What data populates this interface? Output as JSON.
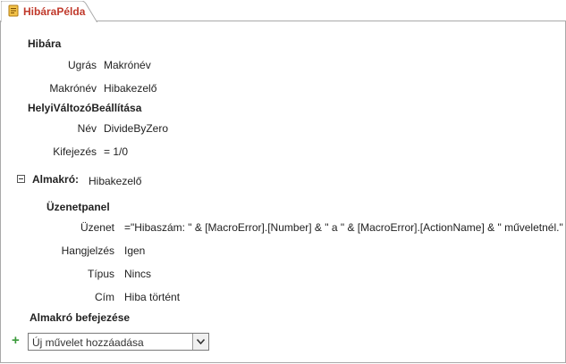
{
  "tab": {
    "title": "HibáraPélda",
    "icon": "macro-scroll-icon"
  },
  "actions": {
    "onerror": {
      "name": "Hibára",
      "args": [
        {
          "label": "Ugrás",
          "value": "Makrónév"
        },
        {
          "label": "Makrónév",
          "value": "Hibakezelő"
        }
      ]
    },
    "setlocal": {
      "name": "HelyiVáltozóBeállítása",
      "args": [
        {
          "label": "Név",
          "value": "DivideByZero"
        },
        {
          "label": "Kifejezés",
          "value": "= 1/0"
        }
      ]
    },
    "submacro": {
      "label": "Almakró:",
      "value": "Hibakezelő",
      "expander_icon": "collapse-minus-icon"
    },
    "messagebox": {
      "name": "Üzenetpanel",
      "args": [
        {
          "label": "Üzenet",
          "value": "=\"Hibaszám: \" & [MacroError].[Number] & \" a \" & [MacroError].[ActionName] & \" műveletnél.\""
        },
        {
          "label": "Hangjelzés",
          "value": "Igen"
        },
        {
          "label": "Típus",
          "value": "Nincs"
        },
        {
          "label": "Cím",
          "value": "Hiba történt"
        }
      ]
    },
    "end_submacro": "Almakró befejezése"
  },
  "add_action": {
    "icon": "add-plus-icon",
    "placeholder": "Új művelet hozzáadása",
    "dropdown_icon": "chevron-down-icon"
  },
  "colors": {
    "tab_title": "#c0392b",
    "border": "#a9a9a9",
    "plus": "#3a9a3a"
  }
}
